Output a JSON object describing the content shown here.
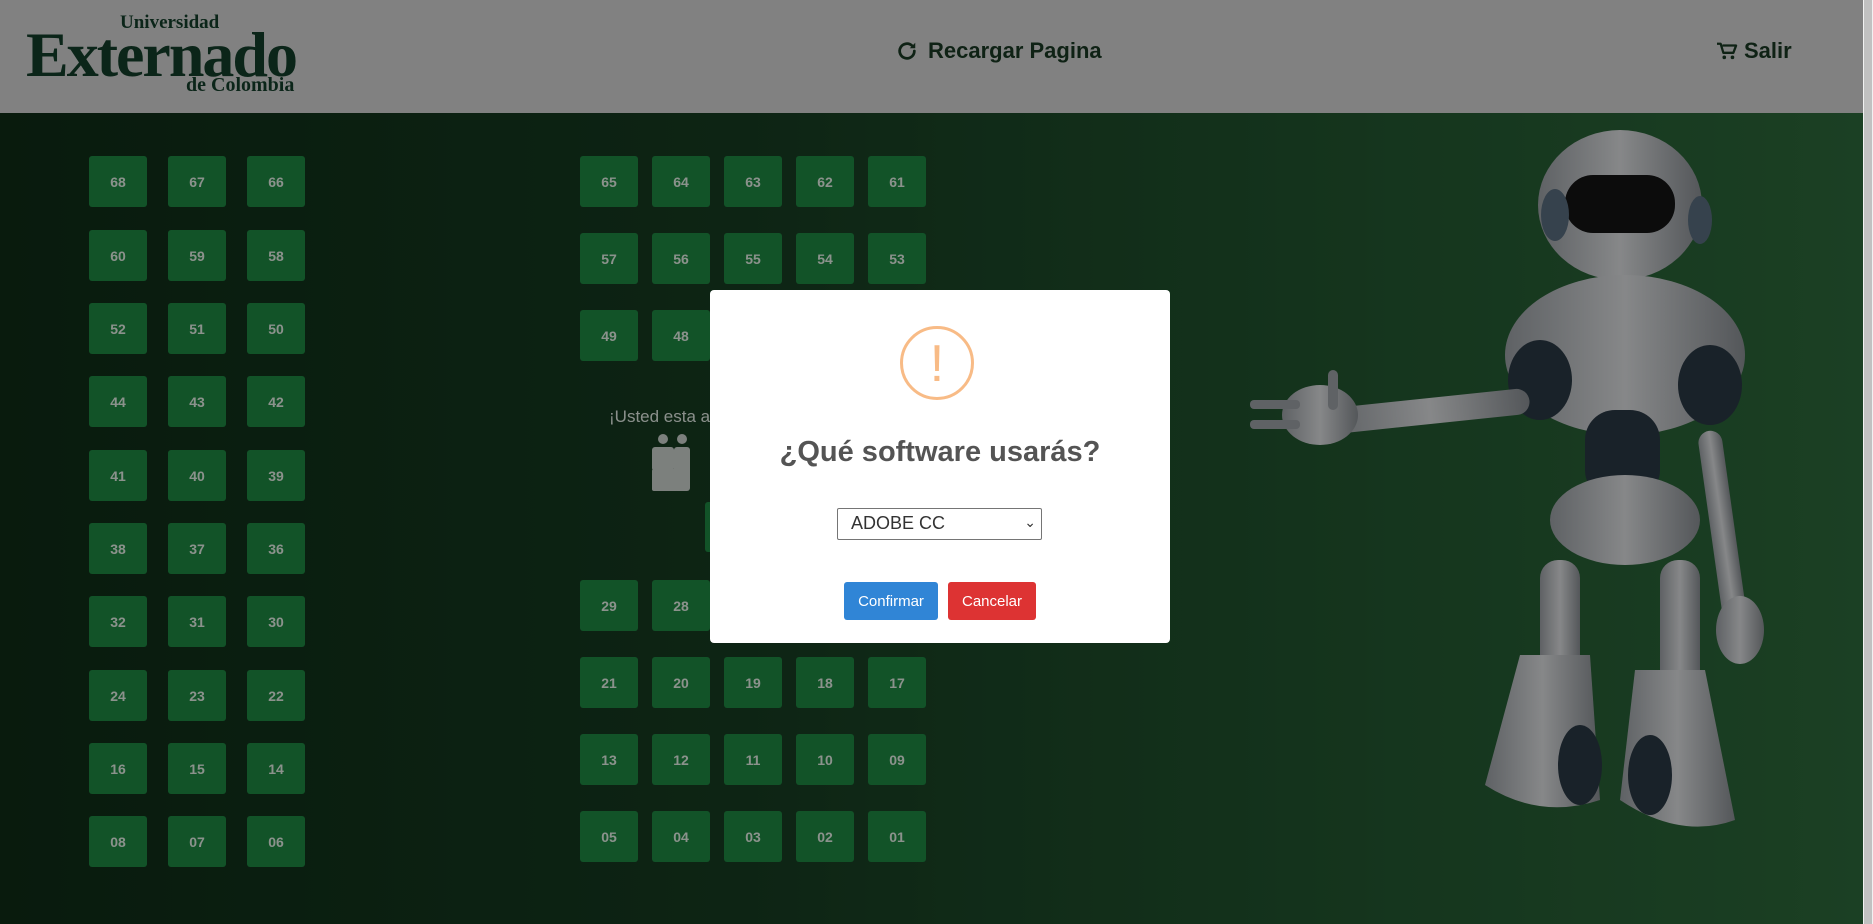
{
  "header": {
    "logo": {
      "line1": "Universidad",
      "line2": "Externado",
      "line3": "de Colombia"
    },
    "reload_label": "Recargar Pagina",
    "logout_label": "Salir"
  },
  "seats": {
    "left_rows": [
      [
        "68",
        "67",
        "66"
      ],
      [
        "60",
        "59",
        "58"
      ],
      [
        "52",
        "51",
        "50"
      ],
      [
        "44",
        "43",
        "42"
      ],
      [
        "41",
        "40",
        "39"
      ],
      [
        "38",
        "37",
        "36"
      ],
      [
        "32",
        "31",
        "30"
      ],
      [
        "24",
        "23",
        "22"
      ],
      [
        "16",
        "15",
        "14"
      ],
      [
        "08",
        "07",
        "06"
      ]
    ],
    "right_rows": [
      [
        "65",
        "64",
        "63",
        "62",
        "61"
      ],
      [
        "57",
        "56",
        "55",
        "54",
        "53"
      ],
      [
        "49",
        "48"
      ],
      [
        "29",
        "28"
      ],
      [
        "21",
        "20",
        "19",
        "18",
        "17"
      ],
      [
        "13",
        "12",
        "11",
        "10",
        "09"
      ],
      [
        "05",
        "04",
        "03",
        "02",
        "01"
      ]
    ]
  },
  "status_text": "¡Usted esta a",
  "modal": {
    "icon": "!",
    "title": "¿Qué software usarás?",
    "select_value": "ADOBE CC",
    "confirm_label": "Confirmar",
    "cancel_label": "Cancelar"
  },
  "colors": {
    "seat": "#1e8a43",
    "confirm": "#3085d6",
    "cancel": "#dd3333",
    "warning": "#f8bb86"
  }
}
